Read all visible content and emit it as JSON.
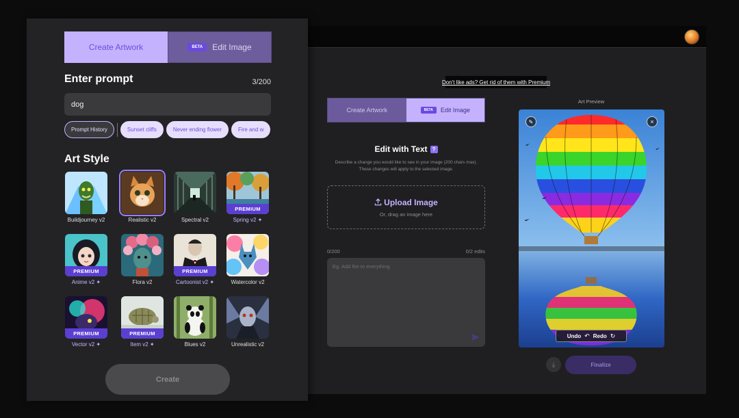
{
  "left_panel": {
    "tabs": {
      "create": "Create Artwork",
      "beta": "BETA",
      "edit": "Edit Image"
    },
    "prompt": {
      "title": "Enter prompt",
      "count": "3/200",
      "value": "dog"
    },
    "chips": [
      "Prompt History",
      "Sunset cliffs",
      "Never ending flower",
      "Fire and w"
    ],
    "art_style": {
      "title": "Art Style",
      "premium_label": "PREMIUM",
      "styles": [
        {
          "label": "Buildjourney v2",
          "premium": false,
          "icon": "green-monster-thumb"
        },
        {
          "label": "Realistic v2",
          "premium": false,
          "selected": true,
          "icon": "kitten-thumb"
        },
        {
          "label": "Spectral v2",
          "premium": false,
          "icon": "corridor-thumb"
        },
        {
          "label": "Spring v2 ✦",
          "premium": true,
          "icon": "forest-thumb"
        },
        {
          "label": "Anime v2 ✦",
          "premium": true,
          "icon": "anime-girl-thumb"
        },
        {
          "label": "Flora v2",
          "premium": false,
          "icon": "flower-face-thumb"
        },
        {
          "label": "Cartoonist v2 ✦",
          "premium": true,
          "icon": "gentleman-thumb"
        },
        {
          "label": "Watercolor v2",
          "premium": false,
          "icon": "watercolor-wolf-thumb"
        },
        {
          "label": "Vector v2 ✦",
          "premium": true,
          "icon": "neon-creature-thumb"
        },
        {
          "label": "Item v2 ✦",
          "premium": true,
          "icon": "turtle-thumb"
        },
        {
          "label": "Blues v2",
          "premium": false,
          "icon": "panda-thumb"
        },
        {
          "label": "Unrealistic v2",
          "premium": false,
          "icon": "dark-fantasy-thumb"
        }
      ]
    },
    "create_button": "Create"
  },
  "right_panel": {
    "ad_link": "Don't like ads? Get rid of them with Premium",
    "tabs": {
      "create": "Create Artwork",
      "beta": "BETA",
      "edit": "Edit Image"
    },
    "edit_with_text": {
      "title": "Edit with Text",
      "help": "?",
      "description": "Describe a change you would like to see in your image (200 chars max). These changes will apply to the selected image."
    },
    "upload": {
      "title": "Upload Image",
      "subtitle": "Or, drag an image here"
    },
    "char_count": "0/200",
    "edits_count": "0/2 edits",
    "edit_placeholder": "Eg. Add fire to everything",
    "preview": {
      "label": "Art Preview",
      "undo": "Undo",
      "redo": "Redo",
      "image": "hot-air-balloon"
    },
    "finalize_button": "Finalize",
    "download_icon": "download-icon"
  },
  "colors": {
    "accent": "#c4b2ff",
    "accent_dark": "#6b4fd9",
    "premium": "#5b3fd1",
    "panel_bg": "#232325",
    "input_bg": "#3a3a3d"
  }
}
